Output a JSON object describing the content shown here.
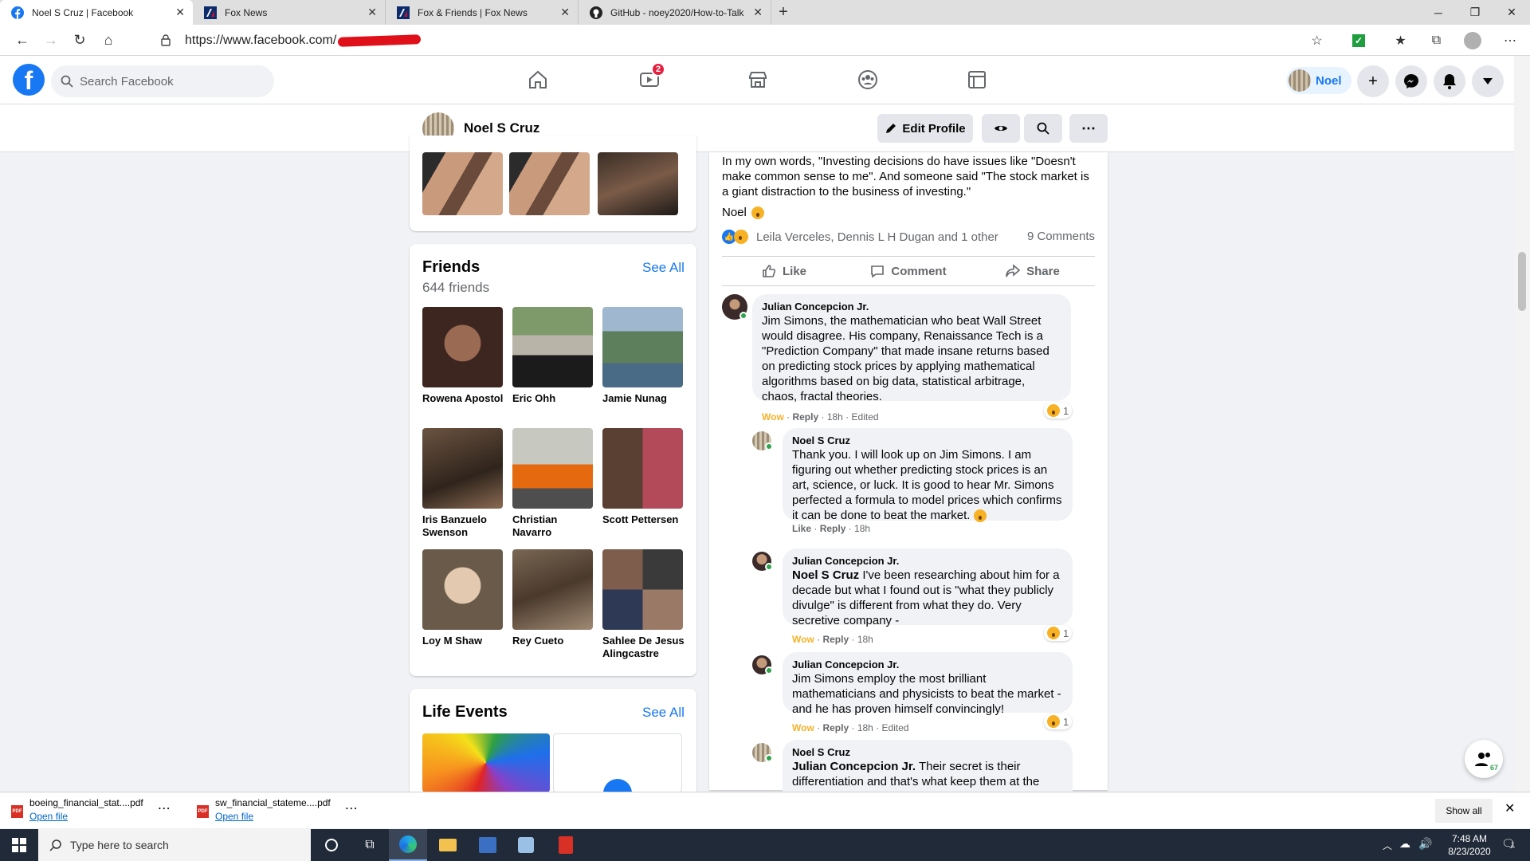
{
  "browser": {
    "tabs": [
      {
        "title": "Noel S Cruz | Facebook",
        "icon": "facebook-icon"
      },
      {
        "title": "Fox News",
        "icon": "foxnews-icon"
      },
      {
        "title": "Fox & Friends | Fox News",
        "icon": "foxnews-icon"
      },
      {
        "title": "GitHub - noey2020/How-to-Talk",
        "icon": "github-icon"
      }
    ],
    "url": "https://www.facebook.com/"
  },
  "fb": {
    "search_placeholder": "Search Facebook",
    "watch_badge": "2",
    "user_name": "Noel"
  },
  "profile": {
    "name": "Noel S Cruz",
    "edit_label": "Edit Profile"
  },
  "friends": {
    "title": "Friends",
    "see_all": "See All",
    "count": "644 friends",
    "list": [
      {
        "name": "Rowena Apostol"
      },
      {
        "name": "Eric Ohh"
      },
      {
        "name": "Jamie Nunag"
      },
      {
        "name": "Iris Banzuelo Swenson"
      },
      {
        "name": "Christian Navarro"
      },
      {
        "name": "Scott Pettersen"
      },
      {
        "name": "Loy M Shaw"
      },
      {
        "name": "Rey Cueto"
      },
      {
        "name": "Sahlee De Jesus Alingcastre"
      }
    ]
  },
  "life_events": {
    "title": "Life Events",
    "see_all": "See All"
  },
  "post": {
    "text": "In my own words, \"Investing decisions do have issues like \"Doesn't make common sense to me\". And someone said \"The stock market is a giant distraction to the business of investing.\"",
    "signature": "Noel",
    "reactors": "Leila Verceles, Dennis L H Dugan and 1 other",
    "comments_count": "9 Comments",
    "actions": {
      "like": "Like",
      "comment": "Comment",
      "share": "Share"
    }
  },
  "comments": [
    {
      "author": "Julian Concepcion Jr.",
      "mention": "",
      "text": "Jim Simons, the mathematician who beat Wall Street would disagree. His company, Renaissance Tech is a \"Prediction Company\" that made insane returns based on predicting stock prices by applying mathematical algorithms based on big data, statistical arbitrage, chaos, fractal theories.",
      "reaction": "Wow",
      "reply": "Reply",
      "time": "18h",
      "edited": "Edited",
      "react_count": "1"
    },
    {
      "author": "Noel S Cruz",
      "mention": "",
      "text": "Thank you. I will look up on Jim Simons. I am figuring out whether predicting stock prices is an art, science, or luck. It is good to hear Mr. Simons perfected a formula to model prices which confirms it can be done to beat the market.",
      "reaction": "Like",
      "reply": "Reply",
      "time": "18h",
      "edited": "",
      "react_count": ""
    },
    {
      "author": "Julian Concepcion Jr.",
      "mention": "Noel S Cruz",
      "text": "I've been researching about him for a decade but what I found out is \"what they publicly divulge\" is different from what they do. Very secretive company -",
      "reaction": "Wow",
      "reply": "Reply",
      "time": "18h",
      "edited": "",
      "react_count": "1"
    },
    {
      "author": "Julian Concepcion Jr.",
      "mention": "",
      "text": "Jim Simons employ the most brilliant mathematicians and physicists to beat the market - and he has proven himself convincingly!",
      "reaction": "Wow",
      "reply": "Reply",
      "time": "18h",
      "edited": "Edited",
      "react_count": "1"
    },
    {
      "author": "Noel S Cruz",
      "mention": "Julian Concepcion Jr.",
      "text": "Their secret is their differentiation and that's what keep them at the",
      "reaction": "",
      "reply": "",
      "time": "",
      "edited": "",
      "react_count": ""
    }
  ],
  "chat_badge": "67",
  "downloads": [
    {
      "file": "boeing_financial_stat....pdf",
      "action": "Open file"
    },
    {
      "file": "sw_financial_stateme....pdf",
      "action": "Open file"
    }
  ],
  "downloads_show_all": "Show all",
  "taskbar": {
    "search_placeholder": "Type here to search",
    "time": "7:48 AM",
    "date": "8/23/2020",
    "notifications": "1"
  },
  "colors": {
    "fb_blue": "#1877f2",
    "wow_yellow": "#f7b125",
    "online_green": "#31a24c"
  }
}
